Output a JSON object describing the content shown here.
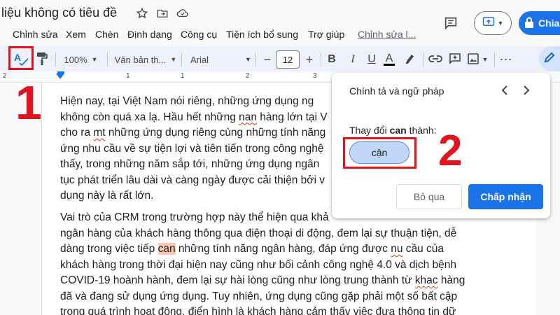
{
  "title_bar": {
    "doc_title": "liệu không có tiêu đề",
    "icons": [
      "star-icon",
      "folder-move-icon",
      "cloud-status-icon",
      "comment-history-icon",
      "present-icon"
    ],
    "share_label": "Chia"
  },
  "menu": {
    "items": [
      "Chỉnh sửa",
      "Xem",
      "Chèn",
      "Định dạng",
      "Công cụ",
      "Tiện ích bổ sung",
      "Trợ giúp"
    ],
    "last_edit": "Chỉnh sửa l..."
  },
  "toolbar": {
    "zoom": "100%",
    "style": "Văn bản th...",
    "font": "Arial",
    "font_size": "12",
    "minus": "−",
    "plus": "+",
    "bold": "B",
    "italic": "I",
    "underline": "U",
    "text_color": "A"
  },
  "ruler": {
    "left_num": "2",
    "num1": "1",
    "num2": "1",
    "num3": "2",
    "num4": "3"
  },
  "annotations": {
    "step1": "1",
    "step2": "2",
    "highlight_color": "#e1131f"
  },
  "document": {
    "para1": [
      "Hiện nay, tại Việt Nam nói riêng, những ứng dụng ng",
      "không còn quá xa lạ. Hầu hết những ",
      "nan",
      " hàng lớn tại V",
      "cho ra ",
      "mt",
      " những ứng dụng riêng cùng những tính năng",
      "ứng nhu cầu về sự tiện lợi và tiên tiến trong công nghệ",
      "thấy, trong những năm sắp tới, những ứng dụng ngân",
      "tục phát triển lâu dài và càng ngày được cải thiện bởi v",
      "dụng này là rất lớn."
    ],
    "para2": [
      "Vai trò của CRM trong trường hợp này thể hiện qua khả",
      "ngân hàng của khách hàng thông qua điện thoại di động, đem lại sự thuận tiện, dễ",
      "dàng trong việc tiếp ",
      "can",
      " những tính năng ngân hàng, đáp ứng được ",
      "nu",
      " cầu của",
      "khách hàng trong thời đại hiện nay cũng như bối cảnh công nghệ 4.0 và dịch bệnh",
      "COVID-19 hoành hành, đem lại sự hài lòng cũng như lòng trung thành từ ",
      "khac",
      " hàng",
      "đã và đang sử dụng ứng dụng. Tuy nhiên, ứng dụng cũng gặp phải một số bất cập",
      "trong quá trình hoạt động, điển hình là khách hàng cảm thấy việc đưa thông tin dữ"
    ]
  },
  "spell_panel": {
    "title": "Chính tả và ngữ pháp",
    "change_prefix": "Thay đổi ",
    "change_word": "can",
    "change_suffix": " thành:",
    "suggestion": "cận",
    "ignore_label": "Bỏ qua",
    "accept_label": "Chấp nhận"
  }
}
